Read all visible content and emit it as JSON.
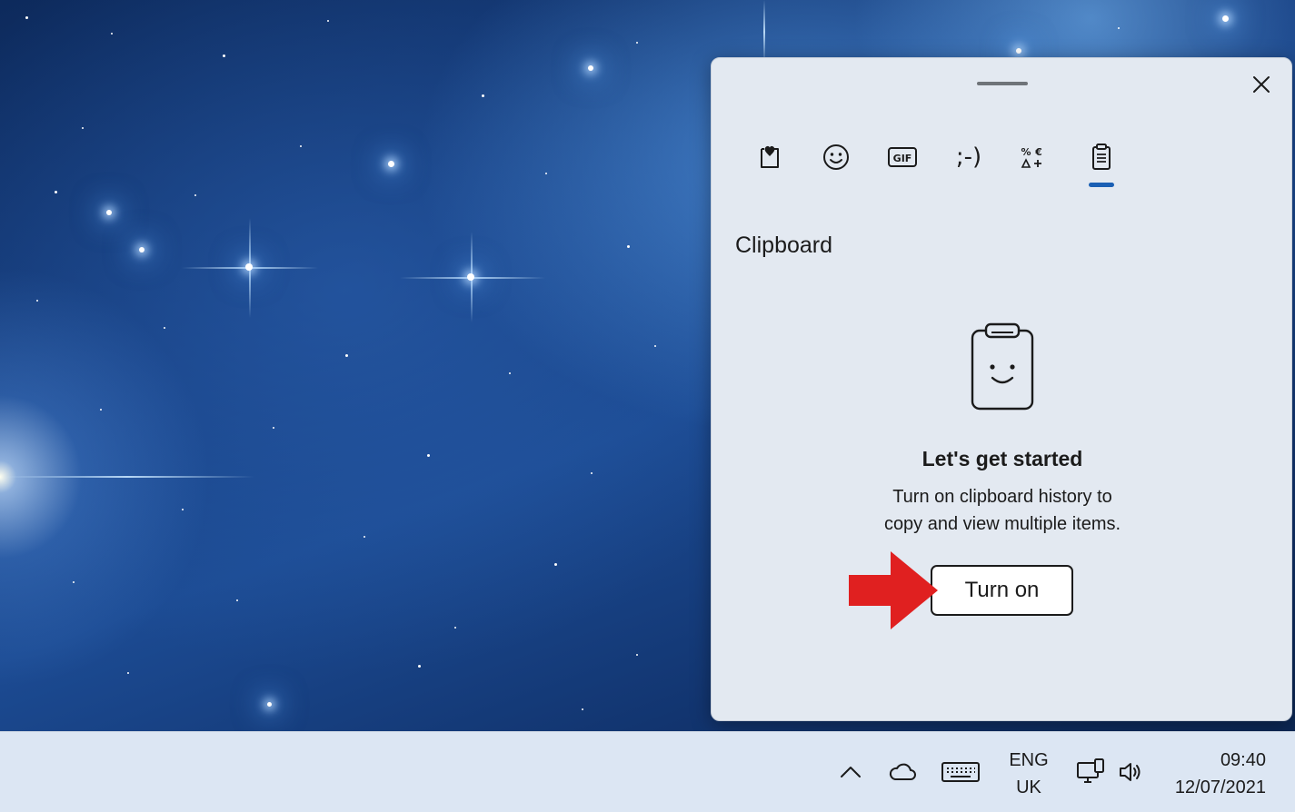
{
  "panel": {
    "tabs": [
      {
        "icon": "favorites-icon",
        "selected": false
      },
      {
        "icon": "emoji-icon",
        "selected": false
      },
      {
        "icon": "gif-icon",
        "selected": false,
        "label": "GIF"
      },
      {
        "icon": "kaomoji-icon",
        "selected": false,
        "label": ";-)"
      },
      {
        "icon": "symbols-icon",
        "selected": false
      },
      {
        "icon": "clipboard-icon",
        "selected": true
      }
    ],
    "section_title": "Clipboard",
    "empty_state": {
      "icon": "smiling-clipboard-icon",
      "heading": "Let's get started",
      "description_line1": "Turn on clipboard history to",
      "description_line2": "copy and view multiple items.",
      "button_label": "Turn on"
    },
    "accent_color": "#1a5fb4"
  },
  "annotation": {
    "icon": "red-arrow-icon",
    "color": "#e02020"
  },
  "taskbar": {
    "tray_icons": [
      "chevron-up-icon",
      "onedrive-cloud-icon",
      "touch-keyboard-icon",
      "network-icon",
      "volume-icon"
    ],
    "language": {
      "line1": "ENG",
      "line2": "UK"
    },
    "clock": {
      "time": "09:40",
      "date": "12/07/2021"
    }
  }
}
